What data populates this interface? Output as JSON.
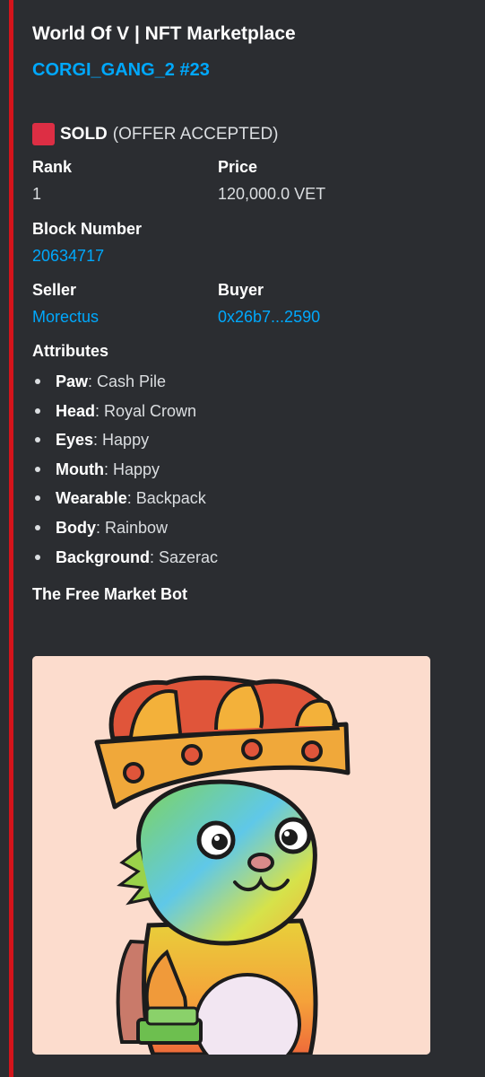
{
  "embed": {
    "author": "World Of V | NFT Marketplace",
    "title": "CORGI_GANG_2 #23",
    "status": {
      "label": "SOLD",
      "note": "(OFFER ACCEPTED)",
      "color": "#dd2e44"
    },
    "fields": {
      "rank": {
        "name": "Rank",
        "value": "1"
      },
      "price": {
        "name": "Price",
        "value": "120,000.0 VET"
      },
      "block": {
        "name": "Block Number",
        "value": "20634717"
      },
      "seller": {
        "name": "Seller",
        "value": "Morectus"
      },
      "buyer": {
        "name": "Buyer",
        "value": "0x26b7...2590"
      }
    },
    "attributes_heading": "Attributes",
    "attributes": [
      {
        "key": "Paw",
        "value": ": Cash Pile"
      },
      {
        "key": "Head",
        "value": ": Royal Crown"
      },
      {
        "key": "Eyes",
        "value": ": Happy"
      },
      {
        "key": "Mouth",
        "value": ": Happy"
      },
      {
        "key": "Wearable",
        "value": ": Backpack"
      },
      {
        "key": "Body",
        "value": ": Rainbow"
      },
      {
        "key": "Background",
        "value": ": Sazerac"
      }
    ],
    "footer": "The Free Market Bot",
    "accent_color": "#d4141b",
    "link_color": "#00a8fc",
    "image_background": "#fcdccd"
  }
}
